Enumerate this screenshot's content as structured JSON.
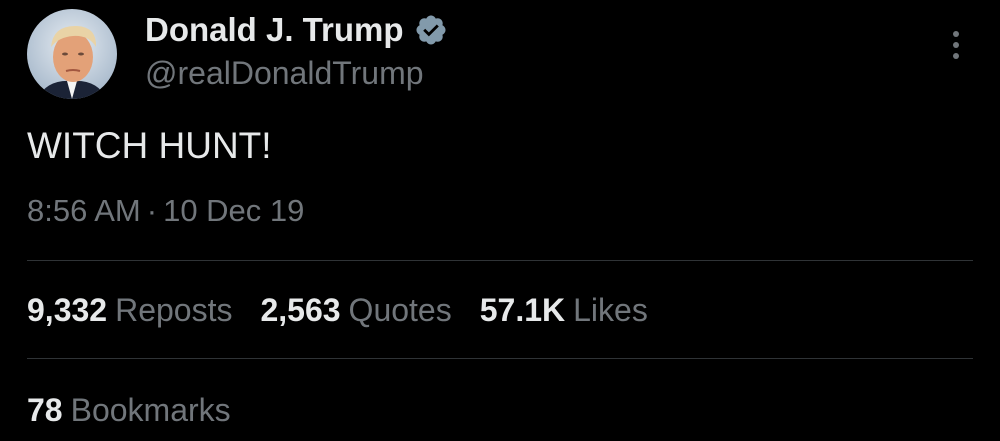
{
  "tweet": {
    "author": {
      "display_name": "Donald J. Trump",
      "handle": "@realDonaldTrump",
      "verified_icon": "verified-badge-icon",
      "avatar_icon": "avatar"
    },
    "text": "WITCH HUNT!",
    "time": "8:56 AM",
    "separator": "·",
    "date": "10 Dec 19",
    "stats": {
      "reposts": {
        "count": "9,332",
        "label": "Reposts"
      },
      "quotes": {
        "count": "2,563",
        "label": "Quotes"
      },
      "likes": {
        "count": "57.1K",
        "label": "Likes"
      },
      "bookmarks": {
        "count": "78",
        "label": "Bookmarks"
      }
    },
    "more_icon": "more-vertical-icon"
  },
  "colors": {
    "background": "#000000",
    "primary_text": "#e7e9ea",
    "secondary_text": "#71767b",
    "divider": "#2f3336",
    "verified_badge": "#829aab"
  }
}
